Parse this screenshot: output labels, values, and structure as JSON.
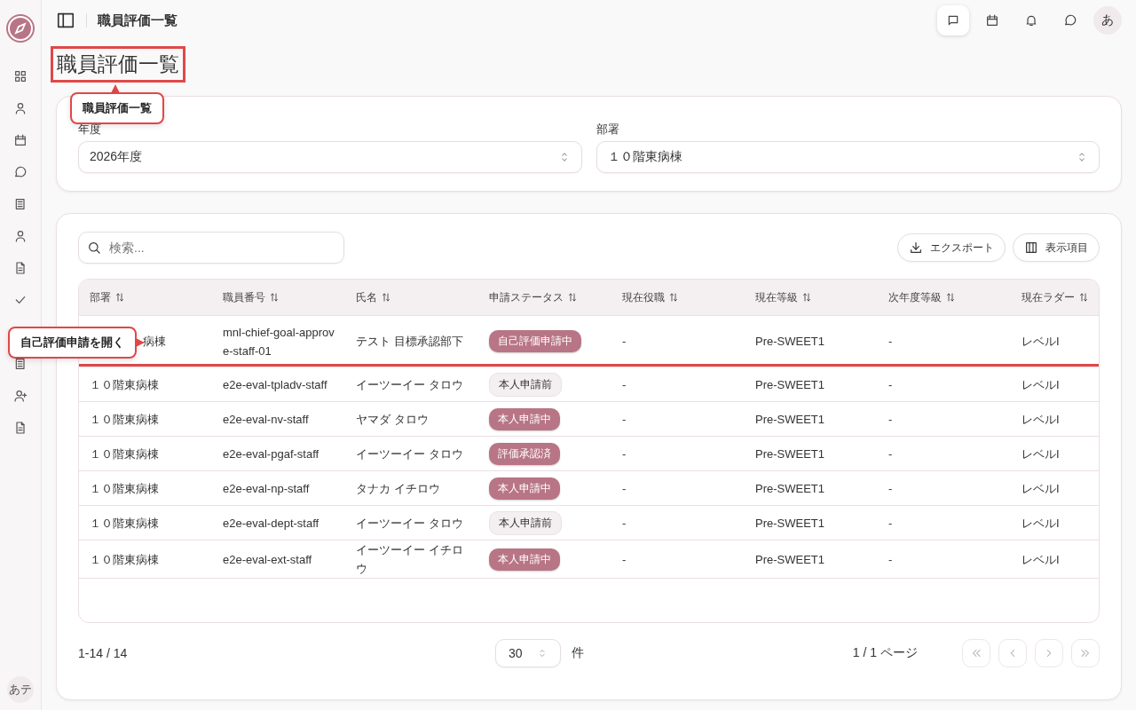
{
  "header": {
    "title": "職員評価一覧",
    "actions": [
      {
        "selected": true
      },
      {
        "selected": false
      },
      {
        "selected": false
      },
      {
        "selected": false
      }
    ],
    "avatar": "あ"
  },
  "sidebar": {
    "avatar": "あテ"
  },
  "page": {
    "title": "職員評価一覧",
    "highlighted": true
  },
  "filters": [
    {
      "label": "年度",
      "value": "2026年度"
    },
    {
      "label": "部署",
      "value": "１０階東病棟"
    }
  ],
  "toolbar": {
    "search": {
      "placeholder": "検索..."
    },
    "buttons": [
      {
        "kind": "export",
        "label": "エクスポート"
      },
      {
        "kind": "columns",
        "label": "表示項目"
      }
    ]
  },
  "table": {
    "columns": [
      "部署",
      "職員番号",
      "氏名",
      "申請ステータス",
      "現在役職",
      "現在等級",
      "次年度等級",
      "現在ラダー"
    ],
    "rows": [
      {
        "highlighted": true,
        "cells": [
          "病棟",
          "mnl-chief-goal-approve-staff-01",
          "テスト 目標承認部下",
          {
            "status": "自己評価申請中",
            "kind": "filled"
          },
          "-",
          "Pre-SWEET1",
          "-",
          "レベルI"
        ]
      },
      {
        "highlighted": false,
        "cells": [
          "１０階東病棟",
          "e2e-eval-tpladv-staff",
          "イーツーイー タロウ",
          {
            "status": "本人申請前",
            "kind": "outline"
          },
          "-",
          "Pre-SWEET1",
          "-",
          "レベルI"
        ]
      },
      {
        "highlighted": false,
        "cells": [
          "１０階東病棟",
          "e2e-eval-nv-staff",
          "ヤマダ タロウ",
          {
            "status": "本人申請中",
            "kind": "filled"
          },
          "-",
          "Pre-SWEET1",
          "-",
          "レベルI"
        ]
      },
      {
        "highlighted": false,
        "cells": [
          "１０階東病棟",
          "e2e-eval-pgaf-staff",
          "イーツーイー タロウ",
          {
            "status": "評価承認済",
            "kind": "filled"
          },
          "-",
          "Pre-SWEET1",
          "-",
          "レベルI"
        ]
      },
      {
        "highlighted": false,
        "cells": [
          "１０階東病棟",
          "e2e-eval-np-staff",
          "タナカ イチロウ",
          {
            "status": "本人申請中",
            "kind": "filled"
          },
          "-",
          "Pre-SWEET1",
          "-",
          "レベルI"
        ]
      },
      {
        "highlighted": false,
        "cells": [
          "１０階東病棟",
          "e2e-eval-dept-staff",
          "イーツーイー タロウ",
          {
            "status": "本人申請前",
            "kind": "outline"
          },
          "-",
          "Pre-SWEET1",
          "-",
          "レベルI"
        ]
      },
      {
        "highlighted": false,
        "cells": [
          "１０階東病棟",
          "e2e-eval-ext-staff",
          "イーツーイー イチロウ",
          {
            "status": "本人申請中",
            "kind": "filled"
          },
          "-",
          "Pre-SWEET1",
          "-",
          "レベルI"
        ]
      }
    ]
  },
  "pagination": {
    "range": "1-14 / 14",
    "page_size": "30",
    "unit": "件",
    "page": "1 / 1 ページ",
    "nav": [
      {
        "disabled": true
      },
      {
        "disabled": true
      },
      {
        "disabled": true
      },
      {
        "disabled": true
      }
    ]
  },
  "tooltips": [
    {
      "kind": "below",
      "text": "職員評価一覧"
    },
    {
      "kind": "left",
      "text": "自己評価申請を開く"
    }
  ]
}
